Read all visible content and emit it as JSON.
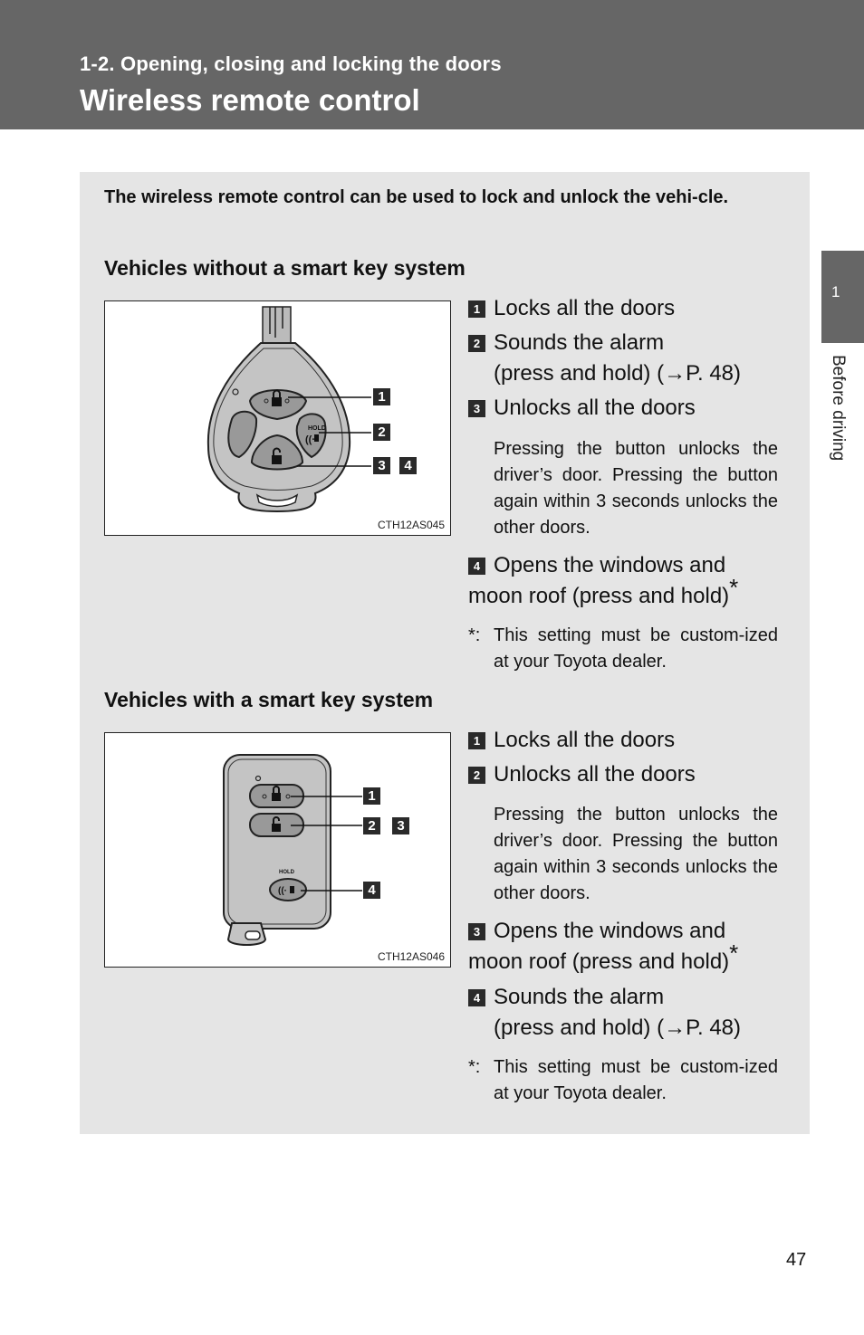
{
  "header": {
    "section": "1-2. Opening, closing and locking the doors",
    "title": "Wireless remote control"
  },
  "side_tab": {
    "number": "1",
    "label": "Before driving"
  },
  "intro": "The wireless remote control can be used to lock and unlock the vehi-cle.",
  "without_smart_key": {
    "heading": "Vehicles without a smart key system",
    "figure": {
      "code": "CTH12AS045",
      "hold_label": "HOLD",
      "callouts": [
        "1",
        "2",
        "3",
        "4"
      ]
    },
    "items": [
      {
        "num": "1",
        "text": "Locks all the doors"
      },
      {
        "num": "2",
        "text": "Sounds the alarm",
        "text2": "(press and hold) (→P. 48)"
      },
      {
        "num": "3",
        "text": "Unlocks all the doors",
        "detail": "Pressing the button unlocks the driver’s door. Pressing the button again within 3 seconds unlocks the other doors."
      },
      {
        "num": "4",
        "text": "Opens the windows and moon roof (press and hold)",
        "star": "*"
      }
    ],
    "note": {
      "mark": "*:",
      "text": "This setting must be custom-ized at your Toyota dealer."
    }
  },
  "with_smart_key": {
    "heading": "Vehicles with a smart key system",
    "figure": {
      "code": "CTH12AS046",
      "hold_label": "HOLD",
      "callouts": [
        "1",
        "2",
        "3",
        "4"
      ]
    },
    "items": [
      {
        "num": "1",
        "text": "Locks all the doors"
      },
      {
        "num": "2",
        "text": "Unlocks all the doors",
        "detail": "Pressing the button unlocks the driver’s door. Pressing the button again within 3 seconds unlocks the other doors."
      },
      {
        "num": "3",
        "text": "Opens the windows and moon roof (press and hold)",
        "star": "*"
      },
      {
        "num": "4",
        "text": "Sounds the alarm",
        "text2": "(press and hold) (→P. 48)"
      }
    ],
    "note": {
      "mark": "*:",
      "text": "This setting must be custom-ized at your Toyota dealer."
    }
  },
  "page_number": "47"
}
